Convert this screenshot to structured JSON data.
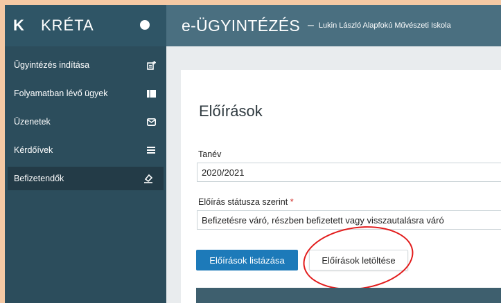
{
  "brand": {
    "logo": "K",
    "name": "KRÉTA"
  },
  "header": {
    "title": "e-ÜGYINTÉZÉS",
    "separator": "–",
    "school": "Lukin László Alapfokú Művészeti Iskola"
  },
  "sidebar": {
    "items": [
      {
        "label": "Ügyintézés indítása",
        "icon": "new-document-icon"
      },
      {
        "label": "Folyamatban lévő ügyek",
        "icon": "folder-icon"
      },
      {
        "label": "Üzenetek",
        "icon": "envelope-icon"
      },
      {
        "label": "Kérdőívek",
        "icon": "list-icon"
      },
      {
        "label": "Befizetendők",
        "icon": "eraser-icon",
        "active": true
      }
    ]
  },
  "main": {
    "title": "Előírások",
    "school_year": {
      "label": "Tanév",
      "value": "2020/2021"
    },
    "status": {
      "label": "Előírás státusza szerint",
      "required_mark": "*",
      "value": "Befizetésre váró, részben befizetett vagy visszautalásra váró"
    },
    "buttons": {
      "list": "Előírások listázása",
      "download": "Előírások letöltése"
    }
  },
  "colors": {
    "sidebar": "#2c4d5c",
    "header": "#4a6f80",
    "primary_button": "#1d7ab9",
    "annotation": "#e21a1a",
    "frame": "#f5c9a4"
  }
}
